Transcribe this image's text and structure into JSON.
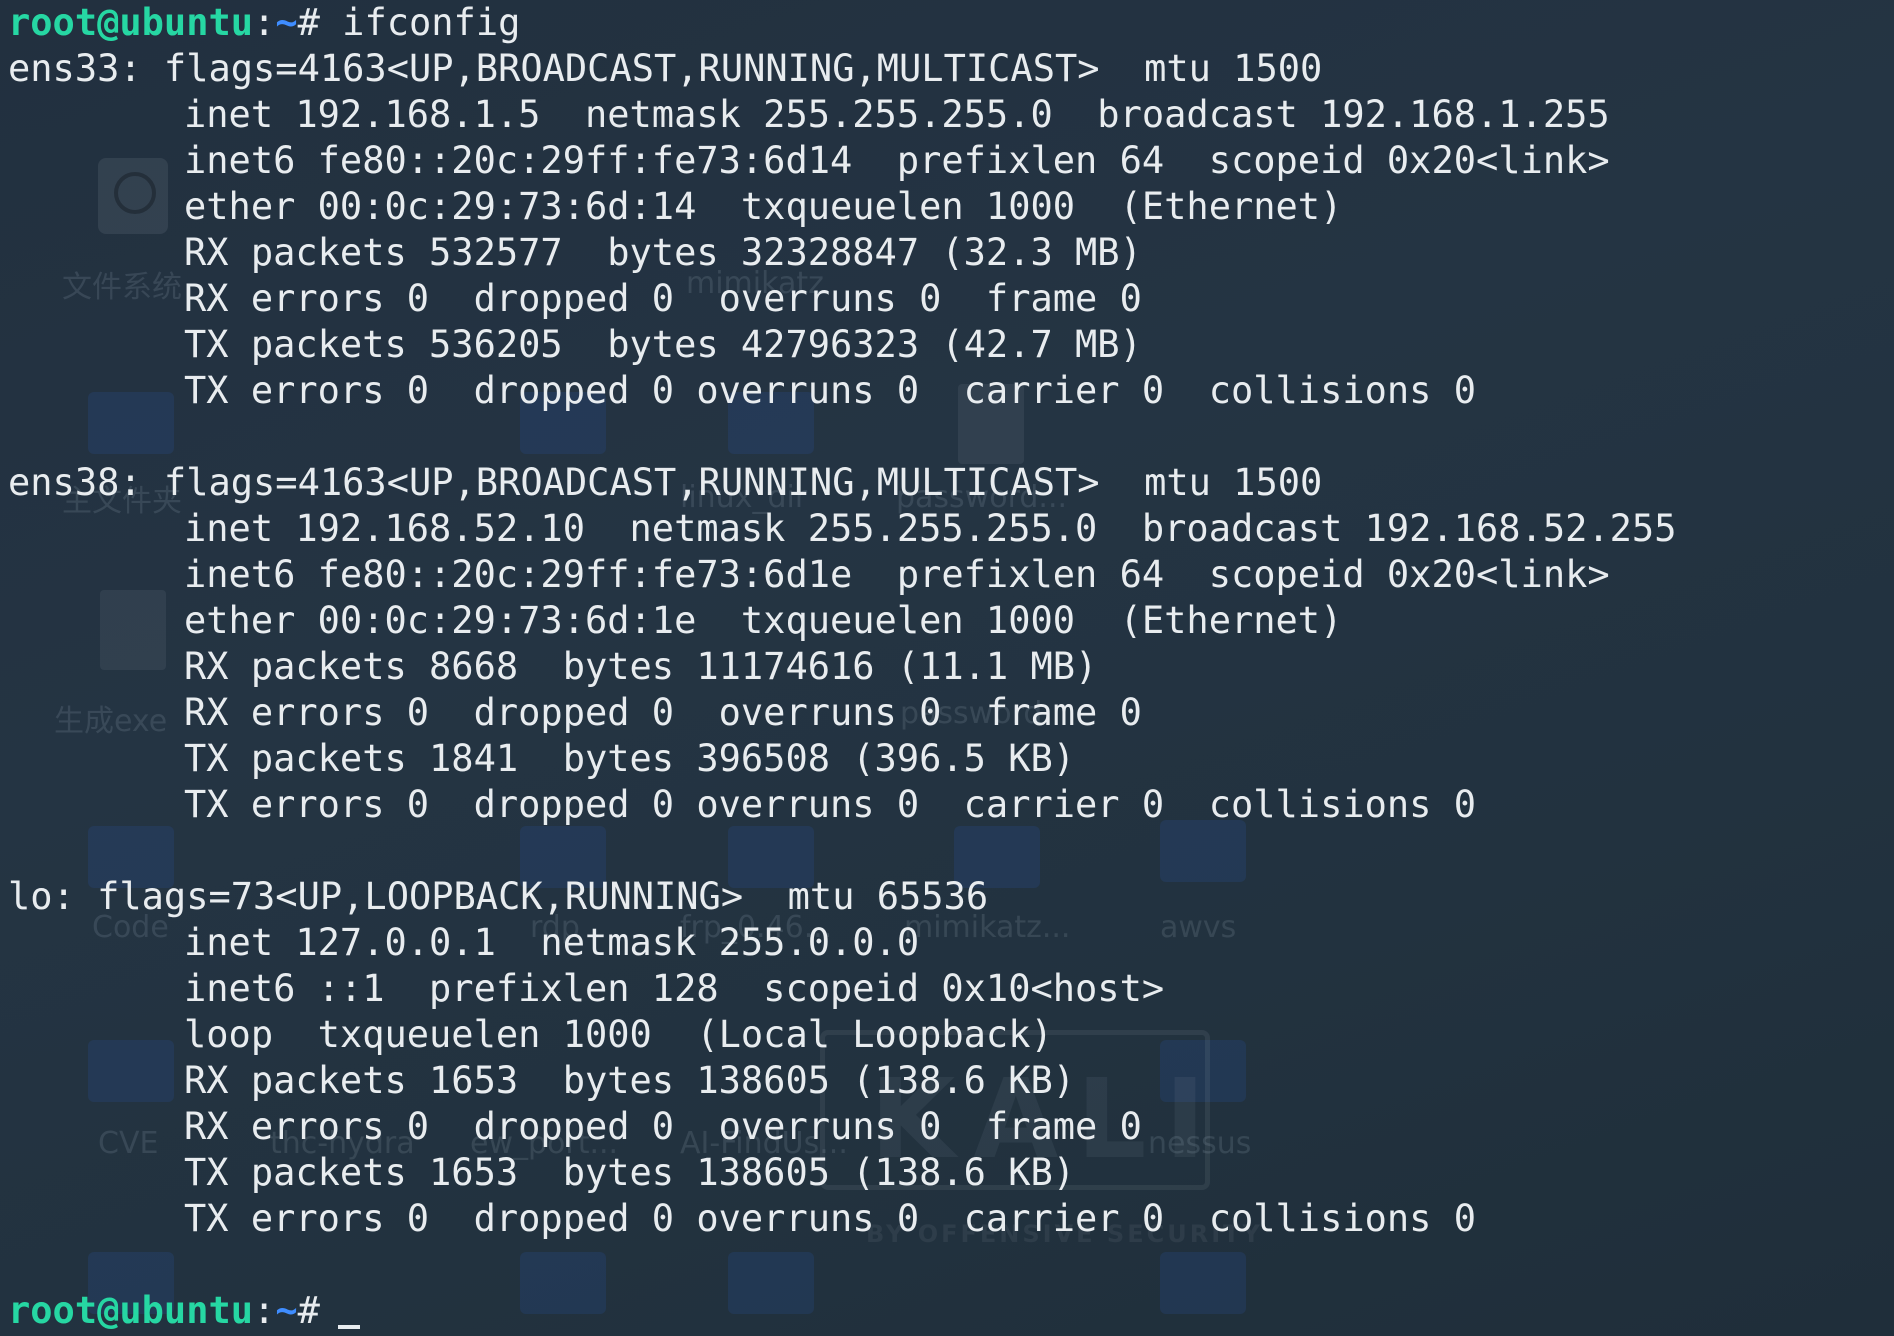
{
  "background_labels": {
    "filesystem": "文件系统",
    "mimikatz_top": "mimikatz",
    "home": "主文件夹",
    "linux_dir": "linux_dir",
    "password_top": "password...",
    "gen_exe": "生成exe",
    "password_mid": "password",
    "code": "Code",
    "rdp": "rdp",
    "frp": "frp_0.46...",
    "mimikatz_mid": "mimikatz...",
    "awvs": "awvs",
    "cve": "CVE",
    "thc_hydra": "thc-hydra",
    "ew_port": "ew_port...",
    "aifindus": "AI-FindUs...",
    "nessus": "nessus",
    "kali_word": "KALI",
    "kali_sub": "BY OFFENSIVE SECURITY"
  },
  "prompt": {
    "user_host": "root@ubuntu",
    "separator": ":",
    "path": "~",
    "symbol": "#",
    "command": " ifconfig"
  },
  "interfaces": [
    {
      "header": "ens33: flags=4163<UP,BROADCAST,RUNNING,MULTICAST>  mtu 1500",
      "lines": [
        "inet 192.168.1.5  netmask 255.255.255.0  broadcast 192.168.1.255",
        "inet6 fe80::20c:29ff:fe73:6d14  prefixlen 64  scopeid 0x20<link>",
        "ether 00:0c:29:73:6d:14  txqueuelen 1000  (Ethernet)",
        "RX packets 532577  bytes 32328847 (32.3 MB)",
        "RX errors 0  dropped 0  overruns 0  frame 0",
        "TX packets 536205  bytes 42796323 (42.7 MB)",
        "TX errors 0  dropped 0 overruns 0  carrier 0  collisions 0"
      ]
    },
    {
      "header": "ens38: flags=4163<UP,BROADCAST,RUNNING,MULTICAST>  mtu 1500",
      "lines": [
        "inet 192.168.52.10  netmask 255.255.255.0  broadcast 192.168.52.255",
        "inet6 fe80::20c:29ff:fe73:6d1e  prefixlen 64  scopeid 0x20<link>",
        "ether 00:0c:29:73:6d:1e  txqueuelen 1000  (Ethernet)",
        "RX packets 8668  bytes 11174616 (11.1 MB)",
        "RX errors 0  dropped 0  overruns 0  frame 0",
        "TX packets 1841  bytes 396508 (396.5 KB)",
        "TX errors 0  dropped 0 overruns 0  carrier 0  collisions 0"
      ]
    },
    {
      "header": "lo: flags=73<UP,LOOPBACK,RUNNING>  mtu 65536",
      "lines": [
        "inet 127.0.0.1  netmask 255.0.0.0",
        "inet6 ::1  prefixlen 128  scopeid 0x10<host>",
        "loop  txqueuelen 1000  (Local Loopback)",
        "RX packets 1653  bytes 138605 (138.6 KB)",
        "RX errors 0  dropped 0  overruns 0  frame 0",
        "TX packets 1653  bytes 138605 (138.6 KB)",
        "TX errors 0  dropped 0 overruns 0  carrier 0  collisions 0"
      ]
    }
  ],
  "colors": {
    "prompt_user": "#26d7a3",
    "prompt_path": "#3f8dff",
    "text": "#e8ecef",
    "background": "#22303f"
  }
}
